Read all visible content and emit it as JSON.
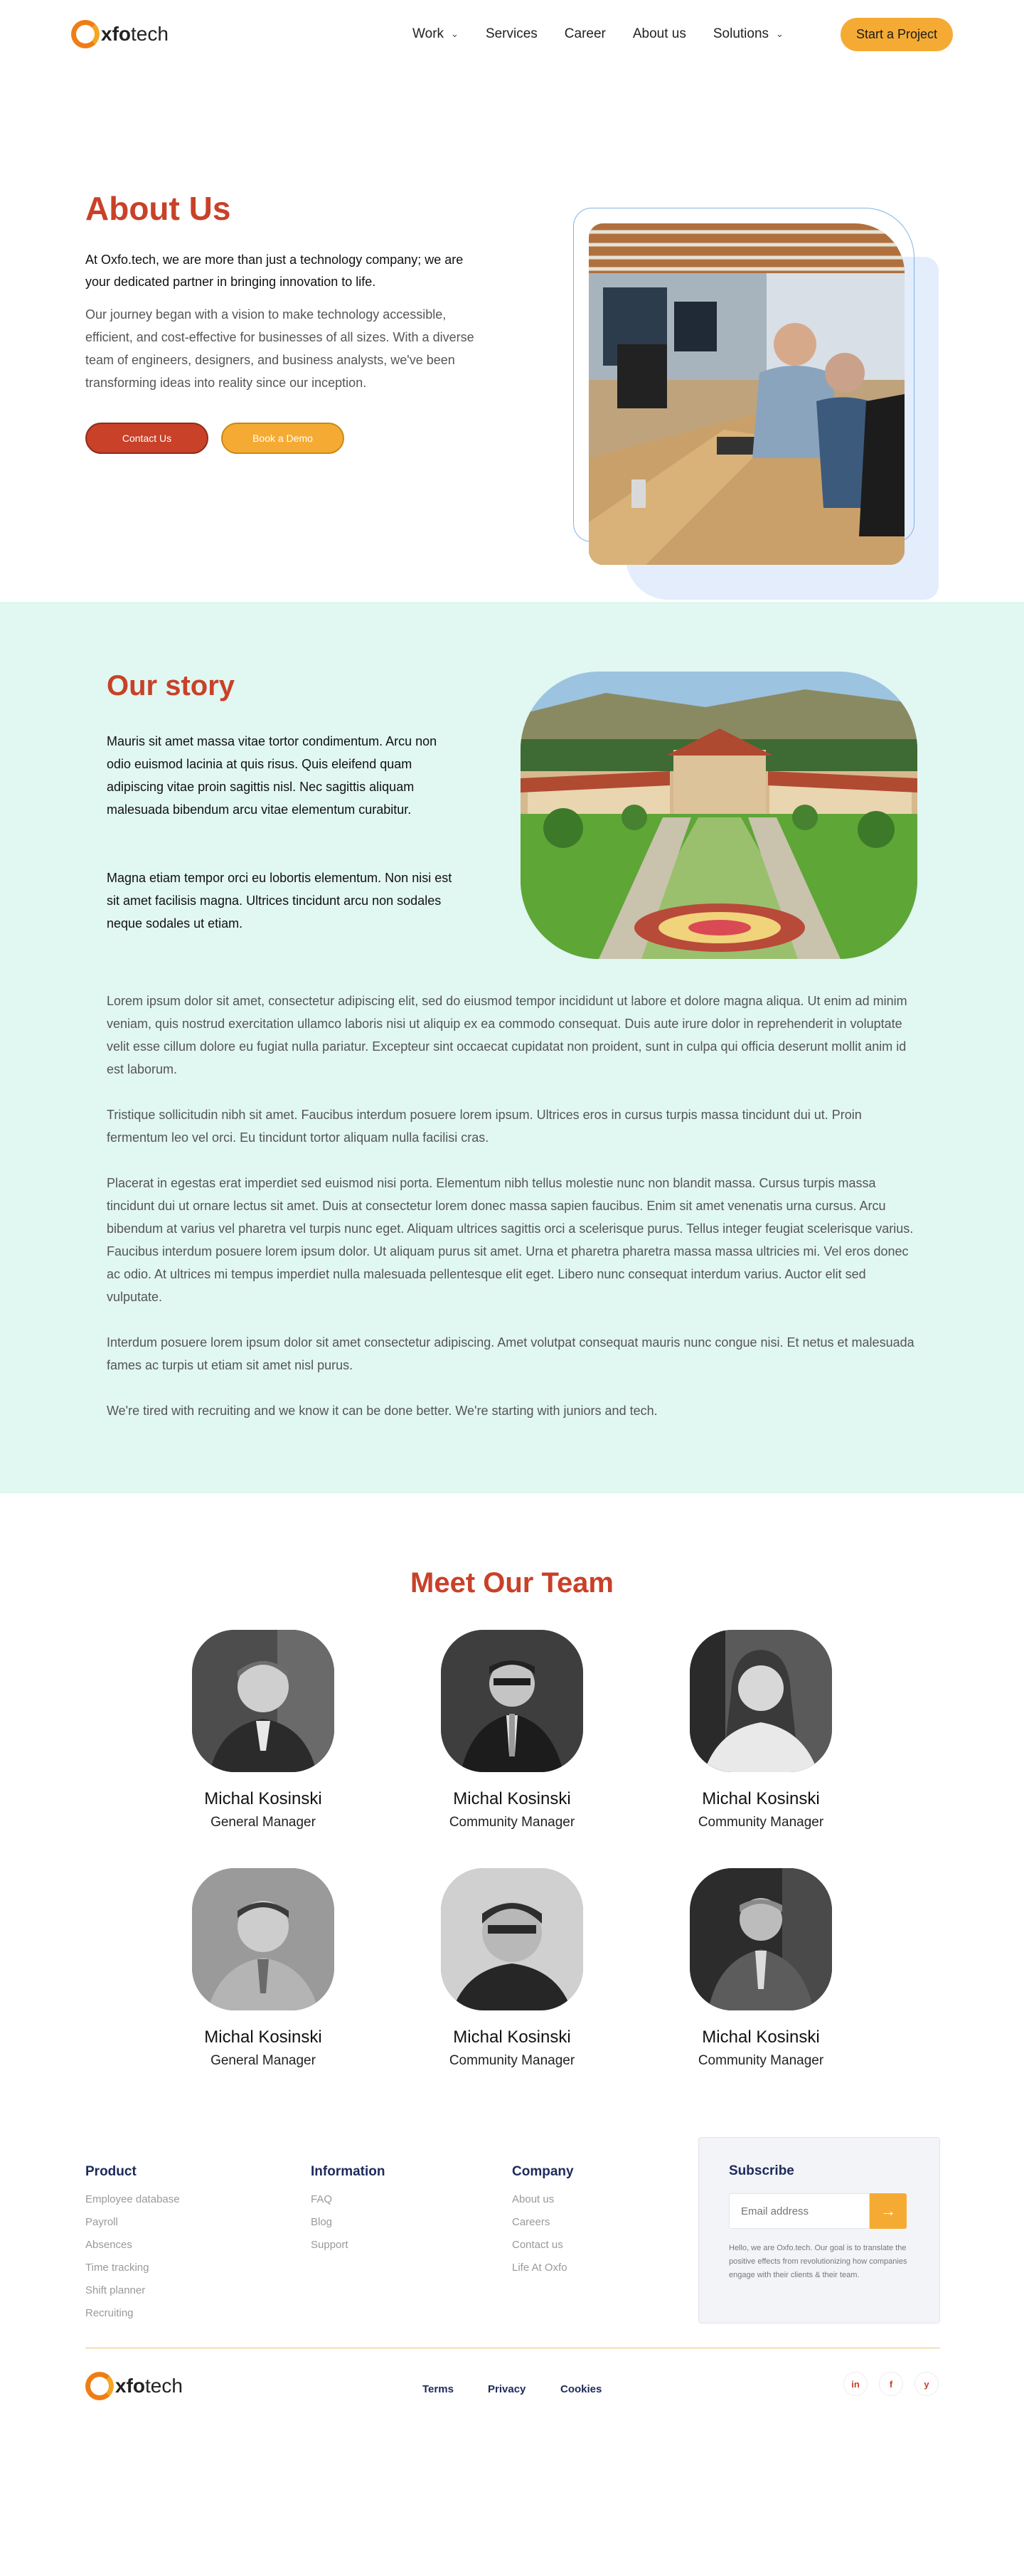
{
  "header": {
    "logo_prefix": "",
    "logo_bold": "xfo",
    "logo_rest": "tech",
    "nav": [
      {
        "label": "Work",
        "dropdown": true
      },
      {
        "label": "Services",
        "dropdown": false
      },
      {
        "label": "Career",
        "dropdown": false
      },
      {
        "label": "About us",
        "dropdown": false
      },
      {
        "label": "Solutions",
        "dropdown": true
      }
    ],
    "cta": "Start a  Project"
  },
  "about": {
    "title": "About Us",
    "lead": "At Oxfo.tech, we are more than just a technology company; we are your dedicated partner in bringing innovation to life.",
    "body": "Our journey began with a vision to make technology accessible, efficient, and cost-effective for businesses of all sizes. With a diverse team of engineers, designers, and business analysts, we've been transforming ideas into reality since our inception.",
    "contact_btn": "Contact Us",
    "demo_btn": "Book a Demo"
  },
  "story": {
    "title": "Our story",
    "p1": "Mauris sit amet massa vitae tortor condimentum. Arcu non odio euismod lacinia at quis risus. Quis eleifend quam adipiscing vitae proin sagittis nisl. Nec sagittis aliquam malesuada bibendum arcu vitae elementum curabitur.",
    "p2": "Magna etiam tempor orci eu lobortis elementum. Non nisi est sit amet facilisis magna. Ultrices tincidunt arcu non sodales neque sodales ut etiam.",
    "long": [
      "Lorem ipsum dolor sit amet, consectetur adipiscing elit, sed do eiusmod tempor incididunt ut labore et dolore magna aliqua. Ut enim ad minim veniam, quis nostrud exercitation ullamco laboris nisi ut aliquip ex ea commodo consequat. Duis aute irure dolor in reprehenderit in voluptate velit esse cillum dolore eu fugiat nulla pariatur. Excepteur sint occaecat cupidatat non proident, sunt in culpa qui officia deserunt mollit anim id est laborum.",
      "Tristique sollicitudin nibh sit amet. Faucibus interdum posuere lorem ipsum. Ultrices eros in cursus turpis massa tincidunt dui ut. Proin fermentum leo vel orci. Eu tincidunt tortor aliquam nulla facilisi cras.",
      "Placerat in egestas erat imperdiet sed euismod nisi porta. Elementum nibh tellus molestie nunc non blandit massa. Cursus turpis massa tincidunt dui ut ornare lectus sit amet. Duis at consectetur lorem donec massa sapien faucibus. Enim sit amet venenatis urna cursus. Arcu bibendum at varius vel pharetra vel turpis nunc eget. Aliquam ultrices sagittis orci a scelerisque purus. Tellus integer feugiat scelerisque varius. Faucibus interdum posuere lorem ipsum dolor. Ut aliquam purus sit amet. Urna et pharetra pharetra massa massa ultricies mi. Vel eros donec ac odio. At ultrices mi tempus imperdiet nulla malesuada pellentesque elit eget. Libero nunc consequat interdum varius. Auctor elit sed vulputate.",
      "Interdum posuere lorem ipsum dolor sit amet consectetur adipiscing. Amet volutpat consequat mauris nunc congue nisi. Et netus et malesuada fames ac turpis ut etiam sit amet nisl purus.",
      "We're tired with recruiting and we know it can be done better. We're starting with juniors and tech."
    ]
  },
  "team": {
    "title": "Meet Our Team",
    "members": [
      {
        "name": "Michal Kosinski",
        "role": "General Manager"
      },
      {
        "name": "Michal Kosinski",
        "role": "Community Manager"
      },
      {
        "name": "Michal Kosinski",
        "role": "Community Manager"
      },
      {
        "name": "Michal Kosinski",
        "role": "General Manager"
      },
      {
        "name": "Michal Kosinski",
        "role": "Community Manager"
      },
      {
        "name": "Michal Kosinski",
        "role": "Community Manager"
      }
    ]
  },
  "footer": {
    "product": {
      "title": "Product",
      "links": [
        "Employee database",
        "Payroll",
        "Absences",
        "Time tracking",
        "Shift planner",
        "Recruiting"
      ]
    },
    "information": {
      "title": "Information",
      "links": [
        "FAQ",
        "Blog",
        "Support"
      ]
    },
    "company": {
      "title": "Company",
      "links": [
        "About us",
        "Careers",
        "Contact us",
        "Life At Oxfo"
      ]
    },
    "subscribe": {
      "title": "Subscribe",
      "placeholder": "Email address",
      "note": "Hello, we are Oxfo.tech. Our goal is to translate the positive effects from revolutionizing how companies engage with their clients & their team."
    },
    "legal": [
      "Terms",
      "Privacy",
      "Cookies"
    ],
    "social": [
      {
        "icon": "linkedin-icon",
        "glyph": "in"
      },
      {
        "icon": "facebook-icon",
        "glyph": "f"
      },
      {
        "icon": "twitter-icon",
        "glyph": "y"
      }
    ]
  },
  "colors": {
    "accent": "#c84128",
    "yellow": "#f5ab33",
    "mint": "#e1f7f1",
    "navy": "#1d2a5b"
  }
}
